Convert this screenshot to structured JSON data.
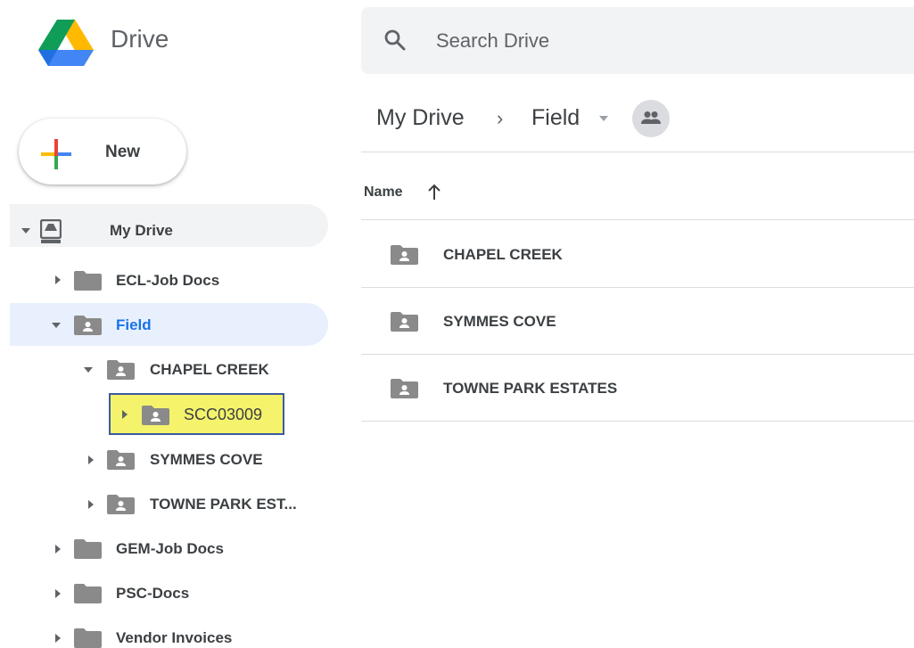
{
  "header": {
    "app_title": "Drive",
    "search_placeholder": "Search Drive"
  },
  "new_button": {
    "label": "New"
  },
  "sidebar": {
    "my_drive": "My Drive",
    "items": [
      {
        "label": "ECL-Job Docs",
        "shared": false,
        "expanded": false
      },
      {
        "label": "Field",
        "shared": true,
        "expanded": true,
        "active": true
      },
      {
        "label": "CHAPEL CREEK",
        "shared": true,
        "expanded": true
      },
      {
        "label": "SCC03009",
        "shared": true,
        "expanded": false,
        "highlighted": true
      },
      {
        "label": "SYMMES COVE",
        "shared": true,
        "expanded": false
      },
      {
        "label": "TOWNE PARK EST...",
        "shared": true,
        "expanded": false
      },
      {
        "label": "GEM-Job Docs",
        "shared": false,
        "expanded": false
      },
      {
        "label": "PSC-Docs",
        "shared": false,
        "expanded": false
      },
      {
        "label": "Vendor Invoices",
        "shared": false,
        "expanded": false
      }
    ]
  },
  "breadcrumb": {
    "root": "My Drive",
    "separator": "›",
    "current": "Field"
  },
  "list": {
    "column_name": "Name",
    "rows": [
      {
        "name": "CHAPEL CREEK"
      },
      {
        "name": "SYMMES COVE"
      },
      {
        "name": "TOWNE PARK ESTATES"
      }
    ]
  },
  "colors": {
    "accent": "#1a73e8",
    "active_bg": "#e8f0fe",
    "highlight": "#f4f36b",
    "folder_gray": "#8a8a8a"
  }
}
